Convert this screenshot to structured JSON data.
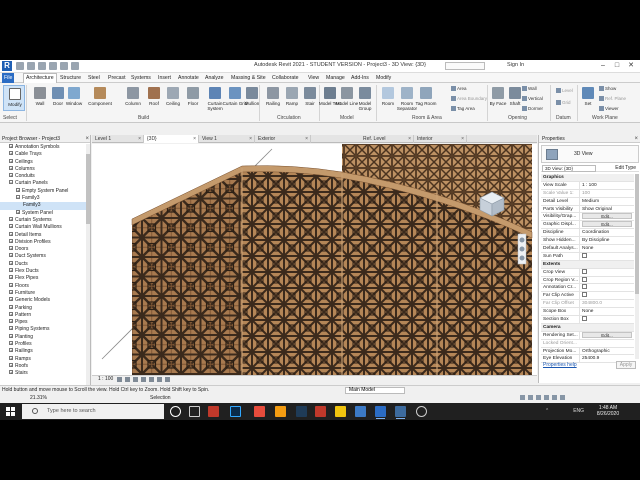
{
  "titlebar": {
    "title": "Autodesk Revit 2021 - STUDENT VERSION - Project3 - 3D View: {3D}",
    "sign_in": "Sign In",
    "logo": "R"
  },
  "ribbon_tabs": [
    "Architecture",
    "Structure",
    "Steel",
    "Precast",
    "Systems",
    "Insert",
    "Annotate",
    "Analyze",
    "Massing & Site",
    "Collaborate",
    "View",
    "Manage",
    "Add-Ins",
    "Modify"
  ],
  "ribbon_file": "File",
  "ribbon": {
    "modify": "Modify",
    "select": "Select",
    "build_buttons": [
      "Wall",
      "Door",
      "Window",
      "Component",
      "Column",
      "Roof",
      "Ceiling",
      "Floor",
      "Curtain System",
      "Curtain Grid",
      "Mullion"
    ],
    "circulation_buttons": [
      "Railing",
      "Ramp",
      "Stair"
    ],
    "model_buttons": [
      "Model Text",
      "Model Line",
      "Model Group"
    ],
    "room_buttons": [
      "Room",
      "Room Separator",
      "Tag Room"
    ],
    "room_small": [
      "Area",
      "Area Boundary",
      "Tag Area"
    ],
    "opening_buttons": [
      "By Face",
      "Shaft"
    ],
    "opening_small": [
      "Wall",
      "Vertical",
      "Dormer"
    ],
    "datum_small": [
      "Level",
      "Grid"
    ],
    "set": "Set",
    "workplane_small": [
      "Show",
      "Ref. Plane",
      "Viewer"
    ],
    "panels": [
      "Build",
      "Circulation",
      "Model",
      "Room & Area",
      "Opening",
      "Datum",
      "Work Plane"
    ]
  },
  "browser": {
    "title": "Project Browser - Project3",
    "items": [
      {
        "label": "Annotation Symbols",
        "indent": 1,
        "exp": "+"
      },
      {
        "label": "Cable Trays",
        "indent": 1,
        "exp": "+"
      },
      {
        "label": "Ceilings",
        "indent": 1,
        "exp": "+"
      },
      {
        "label": "Columns",
        "indent": 1,
        "exp": "+"
      },
      {
        "label": "Conduits",
        "indent": 1,
        "exp": "+"
      },
      {
        "label": "Curtain Panels",
        "indent": 1,
        "exp": "-"
      },
      {
        "label": "Empty System Panel",
        "indent": 2,
        "exp": "+"
      },
      {
        "label": "Family3",
        "indent": 2,
        "exp": "-"
      },
      {
        "label": "Family3",
        "indent": 3,
        "exp": "",
        "selected": true
      },
      {
        "label": "System Panel",
        "indent": 2,
        "exp": "+"
      },
      {
        "label": "Curtain Systems",
        "indent": 1,
        "exp": "+"
      },
      {
        "label": "Curtain Wall Mullions",
        "indent": 1,
        "exp": "+"
      },
      {
        "label": "Detail Items",
        "indent": 1,
        "exp": "+"
      },
      {
        "label": "Division Profiles",
        "indent": 1,
        "exp": "+"
      },
      {
        "label": "Doors",
        "indent": 1,
        "exp": "+"
      },
      {
        "label": "Duct Systems",
        "indent": 1,
        "exp": "+"
      },
      {
        "label": "Ducts",
        "indent": 1,
        "exp": "+"
      },
      {
        "label": "Flex Ducts",
        "indent": 1,
        "exp": "+"
      },
      {
        "label": "Flex Pipes",
        "indent": 1,
        "exp": "+"
      },
      {
        "label": "Floors",
        "indent": 1,
        "exp": "+"
      },
      {
        "label": "Furniture",
        "indent": 1,
        "exp": "+"
      },
      {
        "label": "Generic Models",
        "indent": 1,
        "exp": "+"
      },
      {
        "label": "Parking",
        "indent": 1,
        "exp": "+"
      },
      {
        "label": "Pattern",
        "indent": 1,
        "exp": "+"
      },
      {
        "label": "Pipes",
        "indent": 1,
        "exp": "+"
      },
      {
        "label": "Piping Systems",
        "indent": 1,
        "exp": "+"
      },
      {
        "label": "Planting",
        "indent": 1,
        "exp": "+"
      },
      {
        "label": "Profiles",
        "indent": 1,
        "exp": "+"
      },
      {
        "label": "Railings",
        "indent": 1,
        "exp": "+"
      },
      {
        "label": "Ramps",
        "indent": 1,
        "exp": "+"
      },
      {
        "label": "Roofs",
        "indent": 1,
        "exp": "+"
      },
      {
        "label": "Stairs",
        "indent": 1,
        "exp": "+"
      }
    ]
  },
  "view_tabs": [
    {
      "label": "Level 1",
      "active": false
    },
    {
      "label": "{3D}",
      "active": true
    },
    {
      "label": "View 1",
      "active": false
    },
    {
      "label": "Exterior",
      "active": false
    },
    {
      "label": "Ref. Level",
      "active": false
    },
    {
      "label": "Interior",
      "active": false
    }
  ],
  "view_scale": "1 : 100",
  "properties": {
    "title": "Properties",
    "type_name": "3D View",
    "type_dropdown": "3D View: {3D}",
    "edit_type": "Edit Type",
    "rows": [
      {
        "k": "Graphics",
        "v": "",
        "group": true
      },
      {
        "k": "View Scale",
        "v": "1 : 100"
      },
      {
        "k": "Scale Value 1:",
        "v": "100",
        "dim": true
      },
      {
        "k": "Detail Level",
        "v": "Medium"
      },
      {
        "k": "Parts Visibility",
        "v": "Show Original"
      },
      {
        "k": "Visibility/Grap...",
        "v": "Edit...",
        "btn": true
      },
      {
        "k": "Graphic Displ...",
        "v": "Edit...",
        "btn": true
      },
      {
        "k": "Discipline",
        "v": "Coordination"
      },
      {
        "k": "Show Hidden...",
        "v": "By Discipline"
      },
      {
        "k": "Default Analys...",
        "v": "None"
      },
      {
        "k": "Sun Path",
        "v": "",
        "check": true
      },
      {
        "k": "Extents",
        "v": "",
        "group": true
      },
      {
        "k": "Crop View",
        "v": "",
        "check": true
      },
      {
        "k": "Crop Region V...",
        "v": "",
        "check": true
      },
      {
        "k": "Annotation Cr...",
        "v": "",
        "check": true
      },
      {
        "k": "Far Clip Active",
        "v": "",
        "check": true
      },
      {
        "k": "Far Clip Offset",
        "v": "304800.0",
        "dim": true
      },
      {
        "k": "Scope Box",
        "v": "None"
      },
      {
        "k": "Section Box",
        "v": "",
        "check": true
      },
      {
        "k": "Camera",
        "v": "",
        "group": true
      },
      {
        "k": "Rendering Set...",
        "v": "Edit...",
        "btn": true
      },
      {
        "k": "Locked Orient...",
        "v": "",
        "dim": true
      },
      {
        "k": "Projection Mo...",
        "v": "Orthographic"
      },
      {
        "k": "Eye Elevation",
        "v": "25400.9"
      }
    ],
    "help": "Properties help",
    "apply": "Apply"
  },
  "status": {
    "text": "Hold button and move mouse to Scroll the view. Hold Ctrl key to Zoom. Hold Shift key to Spin.",
    "model": "Main Model",
    "zoom": "21.31%",
    "selection": "Selection"
  },
  "taskbar": {
    "search_placeholder": "Type here to search",
    "lang": "ENG",
    "time": "1:48 AM",
    "date": "8/26/2020"
  },
  "colors": {
    "accent": "#2b6cc4",
    "panel_wood": "#9a6b43",
    "panel_dark": "#3b2a1c",
    "frame": "#c49a6c"
  }
}
